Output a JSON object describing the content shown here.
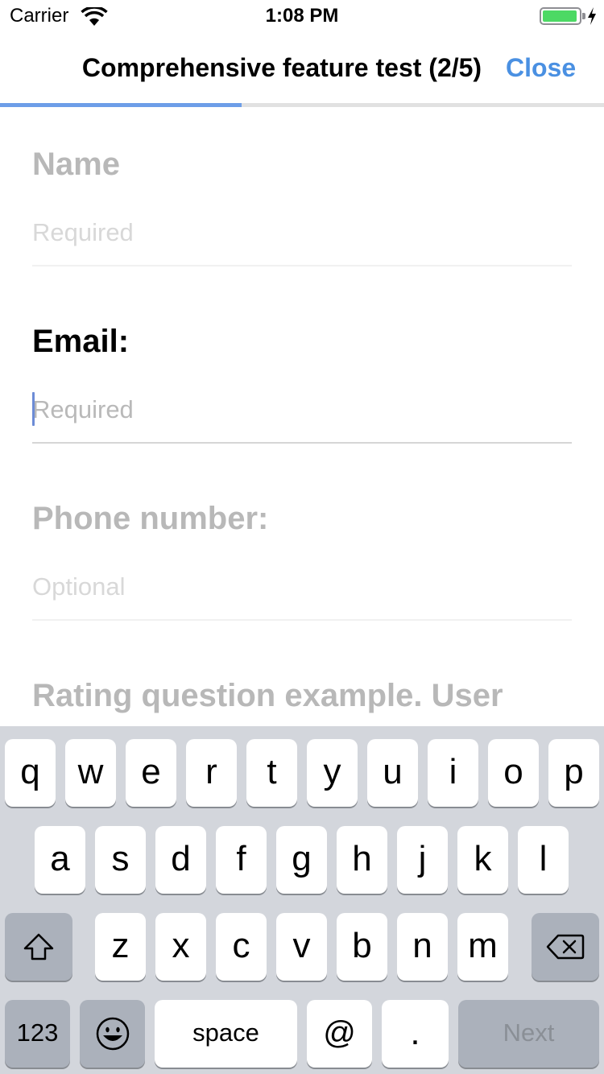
{
  "status_bar": {
    "carrier": "Carrier",
    "time": "1:08 PM",
    "battery_color": "#4cd964",
    "battery_level": 0.95,
    "icons": [
      "wifi-icon",
      "battery-icon",
      "charging-bolt-icon"
    ]
  },
  "nav": {
    "title": "Comprehensive feature test (2/5)",
    "close_label": "Close",
    "accent_color": "#4a90e2",
    "progress": 0.4
  },
  "form": {
    "questions": [
      {
        "label": "Name",
        "placeholder": "Required",
        "value": ""
      },
      {
        "label": "Email:",
        "placeholder": "Required",
        "value": ""
      },
      {
        "label": "Phone number:",
        "placeholder": "Optional",
        "value": ""
      },
      {
        "label": "Rating question example. User"
      }
    ]
  },
  "keyboard": {
    "row1": [
      "q",
      "w",
      "e",
      "r",
      "t",
      "y",
      "u",
      "i",
      "o",
      "p"
    ],
    "row2": [
      "a",
      "s",
      "d",
      "f",
      "g",
      "h",
      "j",
      "k",
      "l"
    ],
    "row3": [
      "z",
      "x",
      "c",
      "v",
      "b",
      "n",
      "m"
    ],
    "numbers_label": "123",
    "space_label": "space",
    "at_label": "@",
    "dot_label": ".",
    "next_label": "Next",
    "icons": [
      "shift-icon",
      "backspace-icon",
      "emoji-icon"
    ]
  }
}
